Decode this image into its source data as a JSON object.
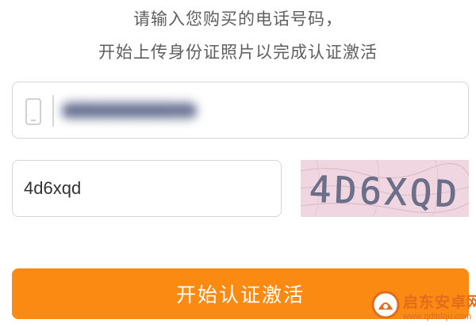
{
  "instructions": {
    "line1": "请输入您购买的电话号码，",
    "line2": "开始上传身份证照片以完成认证激活"
  },
  "phone_field": {
    "icon": "phone-icon",
    "value": "138xxxxxxxx",
    "obscured": true
  },
  "captcha_field": {
    "value": "4d6xqd"
  },
  "captcha_image": {
    "text": "4D6XQD"
  },
  "activate_button": {
    "label": "开始认证激活"
  },
  "watermark": {
    "title": "启东安卓网",
    "url": "www.qdltdqu.com",
    "brand_color": "#e26b1c"
  },
  "colors": {
    "accent": "#fb8a12",
    "border": "#d6d6d6",
    "text": "#5f5f5f"
  }
}
